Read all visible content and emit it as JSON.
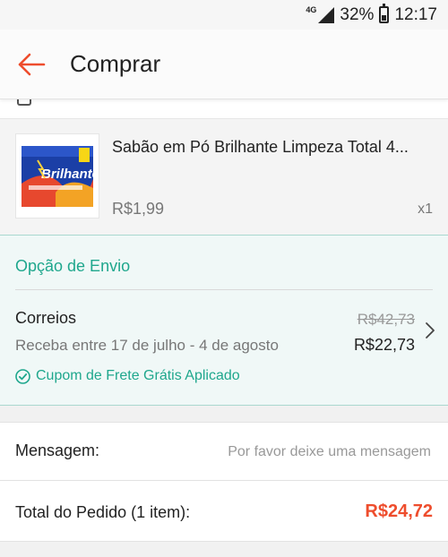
{
  "status_bar": {
    "network": "4G",
    "battery": "32%",
    "time": "12:17"
  },
  "header": {
    "title": "Comprar",
    "back_icon": "arrow-left-icon",
    "accent_color": "#ee4d2d"
  },
  "product": {
    "image_brand": "Brilhante",
    "name": "Sabão em Pó Brilhante Limpeza Total 4...",
    "price": "R$1,99",
    "quantity": "x1"
  },
  "shipping": {
    "header": "Opção de Envio",
    "carrier": "Correios",
    "delivery": "Receba entre 17 de julho - 4 de agosto",
    "old_price": "R$42,73",
    "new_price": "R$22,73",
    "coupon": "Cupom de Frete Grátis Aplicado",
    "accent_color": "#1fa78d"
  },
  "message": {
    "label": "Mensagem:",
    "placeholder": "Por favor deixe uma mensagem"
  },
  "total": {
    "label": "Total do Pedido (1 item):",
    "value": "R$24,72"
  }
}
